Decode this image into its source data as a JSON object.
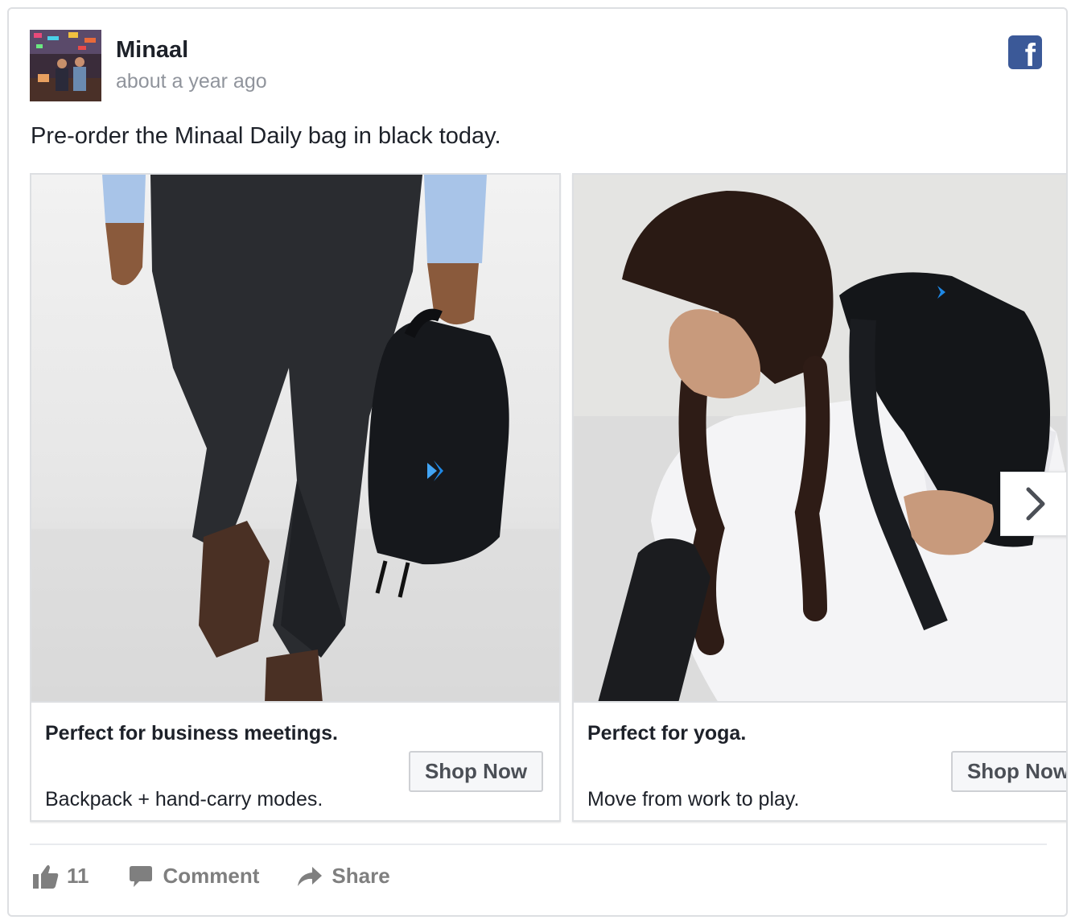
{
  "post": {
    "page_name": "Minaal",
    "timestamp": "about a year ago",
    "message": "Pre-order the Minaal Daily bag in black today.",
    "logo_icon": "facebook-logo-icon",
    "brand_color": "#3b5998"
  },
  "carousel": {
    "cards": [
      {
        "title": "Perfect for business meetings.",
        "description": "Backpack + hand-carry modes.",
        "button_label": "Shop Now"
      },
      {
        "title": "Perfect for yoga.",
        "description": "Move from work to play.",
        "button_label": "Shop Now"
      }
    ],
    "next_icon": "chevron-right-icon"
  },
  "actions": {
    "like_count": "11",
    "comment_label": "Comment",
    "share_label": "Share",
    "like_icon": "thumbs-up-icon",
    "comment_icon": "speech-bubble-icon",
    "share_icon": "share-arrow-icon"
  }
}
